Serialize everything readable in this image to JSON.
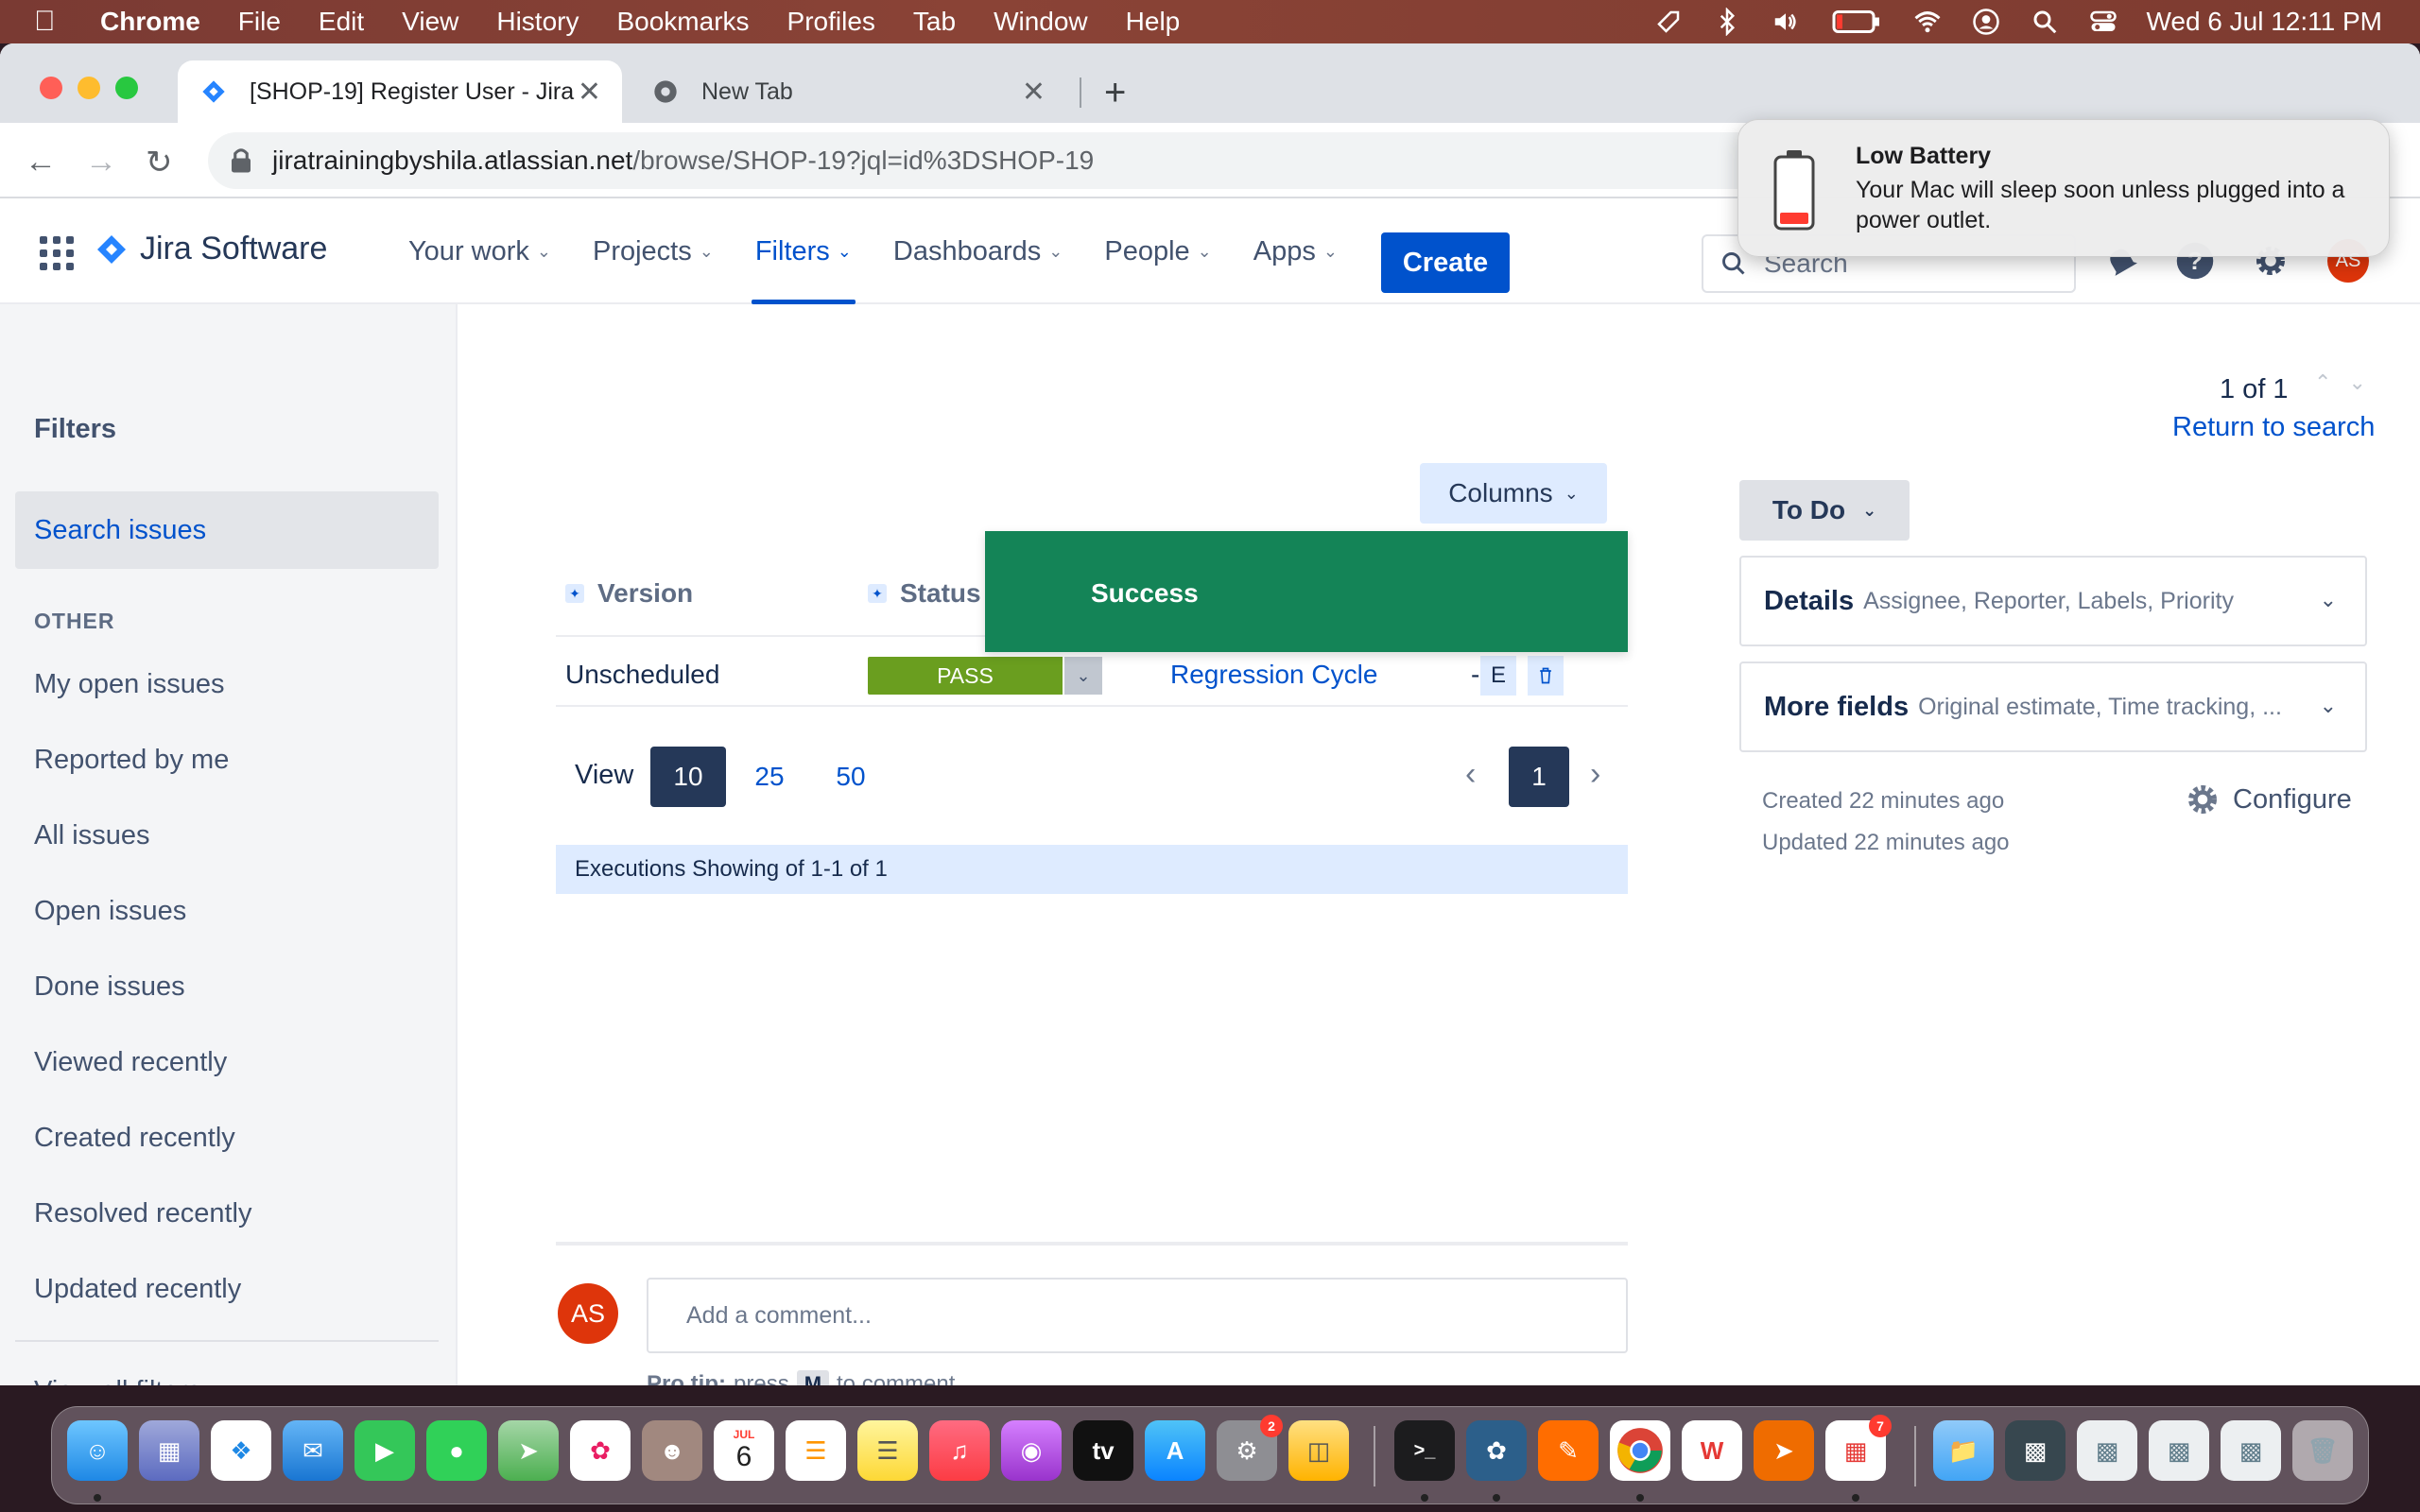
{
  "menubar": {
    "app_name": "Chrome",
    "items": [
      "File",
      "Edit",
      "View",
      "History",
      "Bookmarks",
      "Profiles",
      "Tab",
      "Window",
      "Help"
    ],
    "clock": "Wed 6 Jul  12:11 PM"
  },
  "browser": {
    "tabs": [
      {
        "title": "[SHOP-19] Register User - Jira",
        "active": true
      },
      {
        "title": "New Tab",
        "active": false
      }
    ],
    "url_host": "jiratrainingbyshila.atlassian.net",
    "url_path": "/browse/SHOP-19?jql=id%3DSHOP-19"
  },
  "jira_header": {
    "product": "Jira Software",
    "nav": [
      "Your work",
      "Projects",
      "Filters",
      "Dashboards",
      "People",
      "Apps"
    ],
    "active_nav": "Filters",
    "create_label": "Create",
    "search_placeholder": "Search",
    "avatar_initials": "AS"
  },
  "sidebar": {
    "title": "Filters",
    "search_issues": "Search issues",
    "section_other": "OTHER",
    "items": [
      "My open issues",
      "Reported by me",
      "All issues",
      "Open issues",
      "Done issues",
      "Viewed recently",
      "Created recently",
      "Resolved recently",
      "Updated recently"
    ],
    "view_all": "View all filters"
  },
  "executions": {
    "columns_button": "Columns",
    "headers": [
      "Version",
      "Status"
    ],
    "row": {
      "version": "Unscheduled",
      "status": "PASS",
      "cycle": "Regression Cycle",
      "dash": "-",
      "e_label": "E"
    },
    "toast": "Success",
    "pager": {
      "label": "View",
      "sizes": [
        "10",
        "25",
        "50"
      ],
      "selected_size": "10",
      "page": "1"
    },
    "summary": "Executions Showing of 1-1 of 1"
  },
  "comment": {
    "avatar_initials": "AS",
    "placeholder": "Add a comment...",
    "protip_label": "Pro tip:",
    "protip_press": "press",
    "protip_key": "M",
    "protip_suffix": "to comment"
  },
  "right_panel": {
    "count": "1 of 1",
    "return_link": "Return to search",
    "status_button": "To Do",
    "details_title": "Details",
    "details_sub": "Assignee, Reporter, Labels, Priority",
    "more_title": "More fields",
    "more_sub": "Original estimate, Time tracking, ...",
    "created": "Created 22 minutes ago",
    "updated": "Updated 22 minutes ago",
    "configure": "Configure"
  },
  "notification": {
    "title": "Low Battery",
    "body": "Your Mac will sleep soon unless plugged into a power outlet."
  },
  "dock": {
    "calendar_month": "JUL",
    "calendar_day": "6",
    "appstore_badge": "2",
    "wps_badge": "7"
  },
  "colors": {
    "jira_blue": "#0052cc",
    "pass_green": "#6a9e1f",
    "success_green": "#148457",
    "avatar_red": "#de350b"
  }
}
